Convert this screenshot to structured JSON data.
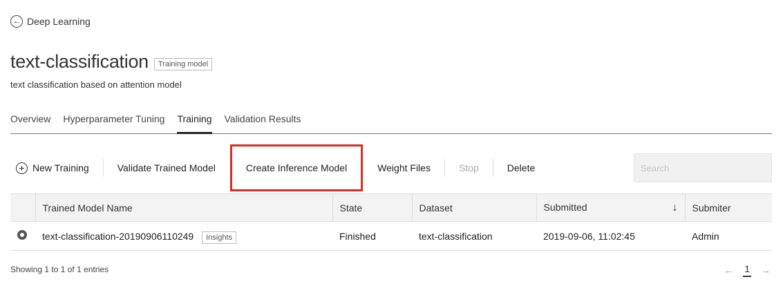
{
  "breadcrumb": {
    "back_icon": "back-arrow-icon",
    "label": "Deep Learning"
  },
  "header": {
    "title": "text-classification",
    "badge": "Training model",
    "subtitle": "text classification based on attention model"
  },
  "tabs": [
    {
      "label": "Overview",
      "active": false
    },
    {
      "label": "Hyperparameter Tuning",
      "active": false
    },
    {
      "label": "Training",
      "active": true
    },
    {
      "label": "Validation Results",
      "active": false
    }
  ],
  "toolbar": {
    "new_training": "New Training",
    "validate": "Validate Trained Model",
    "create_inference": "Create Inference Model",
    "weight_files": "Weight Files",
    "stop": "Stop",
    "delete": "Delete",
    "highlight_color": "#e02a1f"
  },
  "search": {
    "placeholder": "Search",
    "value": ""
  },
  "table": {
    "headers": [
      "Trained Model Name",
      "State",
      "Dataset",
      "Submitted",
      "Submiter"
    ],
    "rows": [
      {
        "name": "text-classification-20190906110249",
        "insights": "Insights",
        "state": "Finished",
        "dataset": "text-classification",
        "submitted": "2019-09-06, 11:02:45",
        "submitter": "Admin"
      }
    ]
  },
  "footer": {
    "showing": "Showing 1 to 1 of 1 entries"
  },
  "pagination": {
    "prev": "←",
    "page": "1",
    "next": "→"
  }
}
